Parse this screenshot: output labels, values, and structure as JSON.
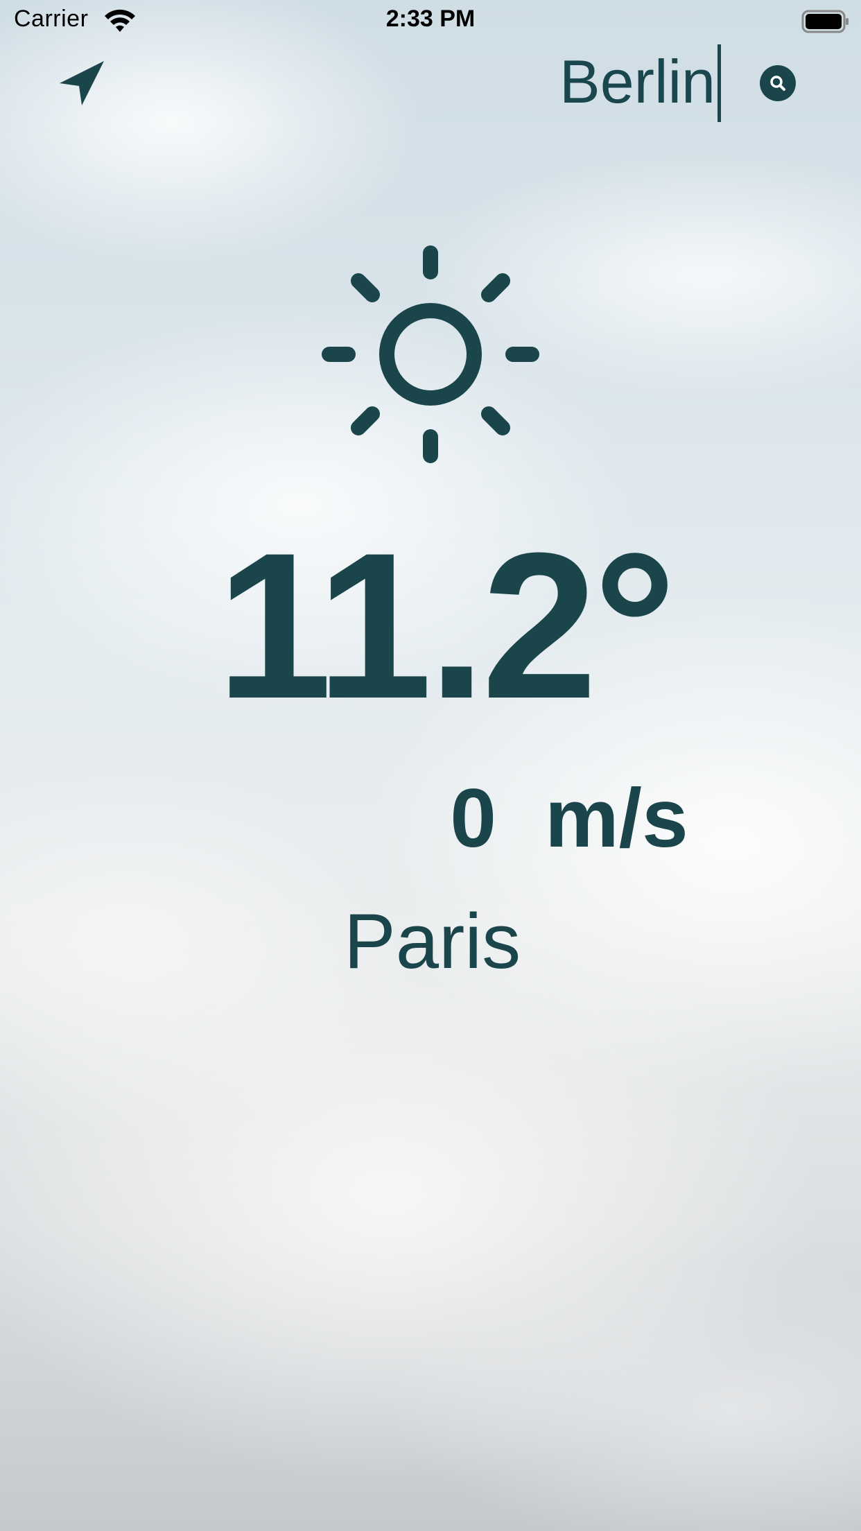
{
  "status_bar": {
    "carrier": "Carrier",
    "time": "2:33 PM"
  },
  "search": {
    "value": "Berlin"
  },
  "weather": {
    "condition_icon": "sun-icon",
    "temperature": "11.2",
    "degree_symbol": "°",
    "wind_speed": "0",
    "wind_unit": "m/s",
    "city": "Paris"
  },
  "icons": {
    "location": "location-arrow-icon",
    "search": "magnifying-glass-icon",
    "wifi": "wifi-icon",
    "battery": "battery-icon"
  },
  "colors": {
    "accent": "#1a454b"
  }
}
